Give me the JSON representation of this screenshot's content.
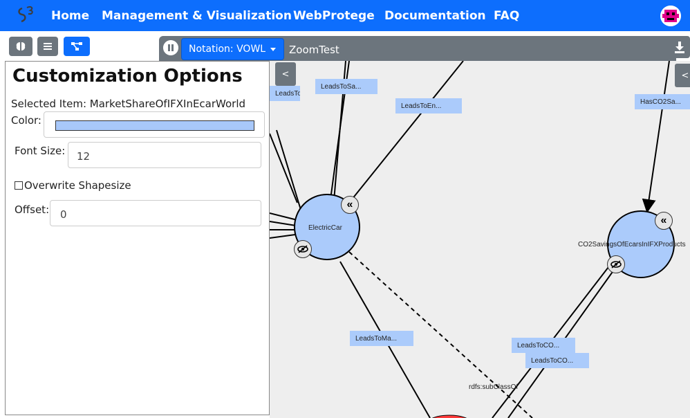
{
  "nav": {
    "logo_icon": "s3-logo-icon",
    "links": [
      "Home",
      "Management & Visualization",
      "WebProtege",
      "Documentation",
      "FAQ"
    ],
    "avatar_icon": "user-avatar-icon"
  },
  "toolbar": {
    "icons": [
      "brain-icon",
      "list-icon",
      "graph-icon"
    ],
    "pause_icon": "pause-icon",
    "notation_label": "Notation: VOWL",
    "tab_title": "ZoomTest",
    "download_icon": "download-icon"
  },
  "panel": {
    "title": "Customization Options",
    "selected_item": "Selected Item: MarketShareOfIFXInEcarWorld",
    "color_label": "Color:",
    "color_value": "#a8c8fa",
    "font_size_label": "Font Size:",
    "font_size_value": "12",
    "overwrite_label": "Overwrite Shapesize",
    "overwrite_checked": false,
    "offset_label": "Offset:",
    "offset_value": "0"
  },
  "graph": {
    "collapse_left": "<",
    "collapse_right": "<",
    "nodes": {
      "electric_car": "ElectricCar",
      "co2_savings": "CO2SavingsOfEcarsInIFXProducts"
    },
    "edges": {
      "leads_to_sa": "LeadsToSa...",
      "leads_to_en": "LeadsToEn...",
      "has_co2": "HasCO2Sa...",
      "leads_to_ave": "LeadsToAve...",
      "leads_to_ma": "LeadsToMa...",
      "leads_to_co_1": "LeadsToCO...",
      "leads_to_co_2": "LeadsToCO...",
      "subclass": "rdfs:subClassOf"
    },
    "colors": {
      "node_fill": "#abcbfb",
      "canvas_bg": "#eeeeee",
      "accent": "#0d6efd"
    }
  }
}
